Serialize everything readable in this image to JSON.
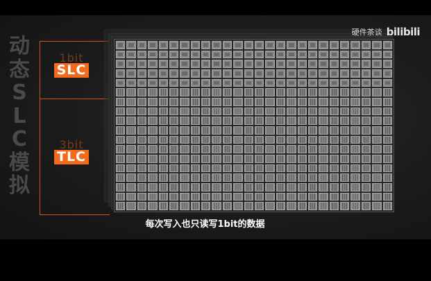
{
  "video": {
    "title_vertical": [
      "动",
      "态",
      "S",
      "L",
      "C",
      "模",
      "拟"
    ],
    "watermark_text": "硬件茶谈",
    "watermark_logo": "bilibili",
    "labels": {
      "top_bits": "1bit",
      "top_tag": "SLC",
      "bottom_bits": "3bit",
      "bottom_tag": "TLC"
    },
    "grid": {
      "columns": 26,
      "slc_rows": 5,
      "tlc_rows": 13
    },
    "subtitle": "每次写入也只读写1bit的数据",
    "colors": {
      "accent": "#f26a1b",
      "bracket": "#d4531c"
    }
  }
}
